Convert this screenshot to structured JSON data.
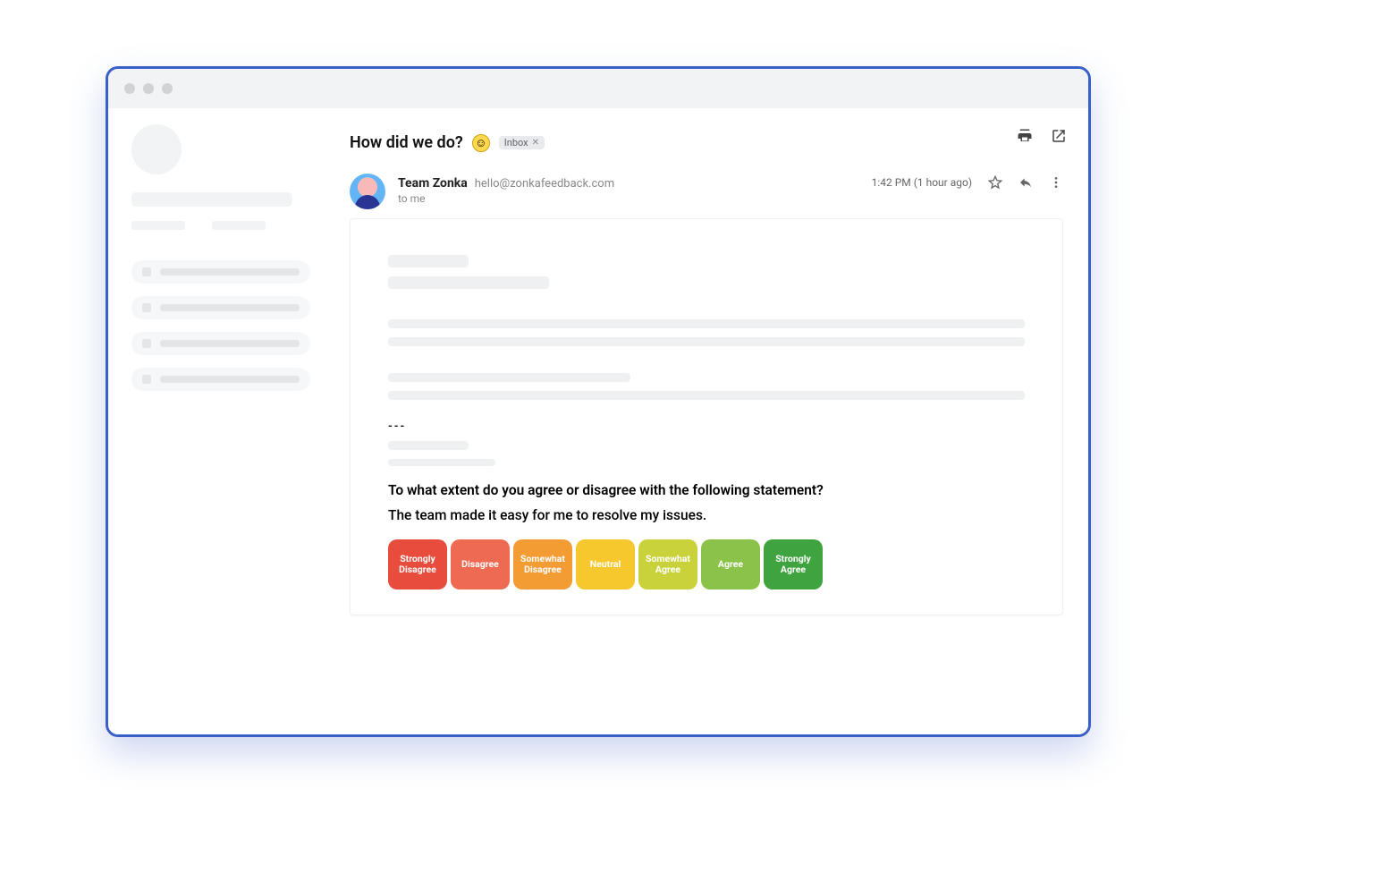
{
  "email": {
    "subject": "How did we do?",
    "label": "Inbox",
    "from_name": "Team Zonka",
    "from_email": "hello@zonkafeedback.com",
    "to": "to me",
    "time": "1:42 PM (1 hour ago)",
    "divider": "---",
    "question": "To what extent do you agree or disagree with the following statement?",
    "statement": "The team made it easy for me to resolve my issues."
  },
  "scale": [
    {
      "label": "Strongly Disagree",
      "color": "#e74c3c"
    },
    {
      "label": "Disagree",
      "color": "#ef6a52"
    },
    {
      "label": "Somewhat Disagree",
      "color": "#f39c33"
    },
    {
      "label": "Neutral",
      "color": "#f7c72e"
    },
    {
      "label": "Somewhat Agree",
      "color": "#c9d23a"
    },
    {
      "label": "Agree",
      "color": "#8bc34a"
    },
    {
      "label": "Strongly Agree",
      "color": "#3fa33f"
    }
  ]
}
